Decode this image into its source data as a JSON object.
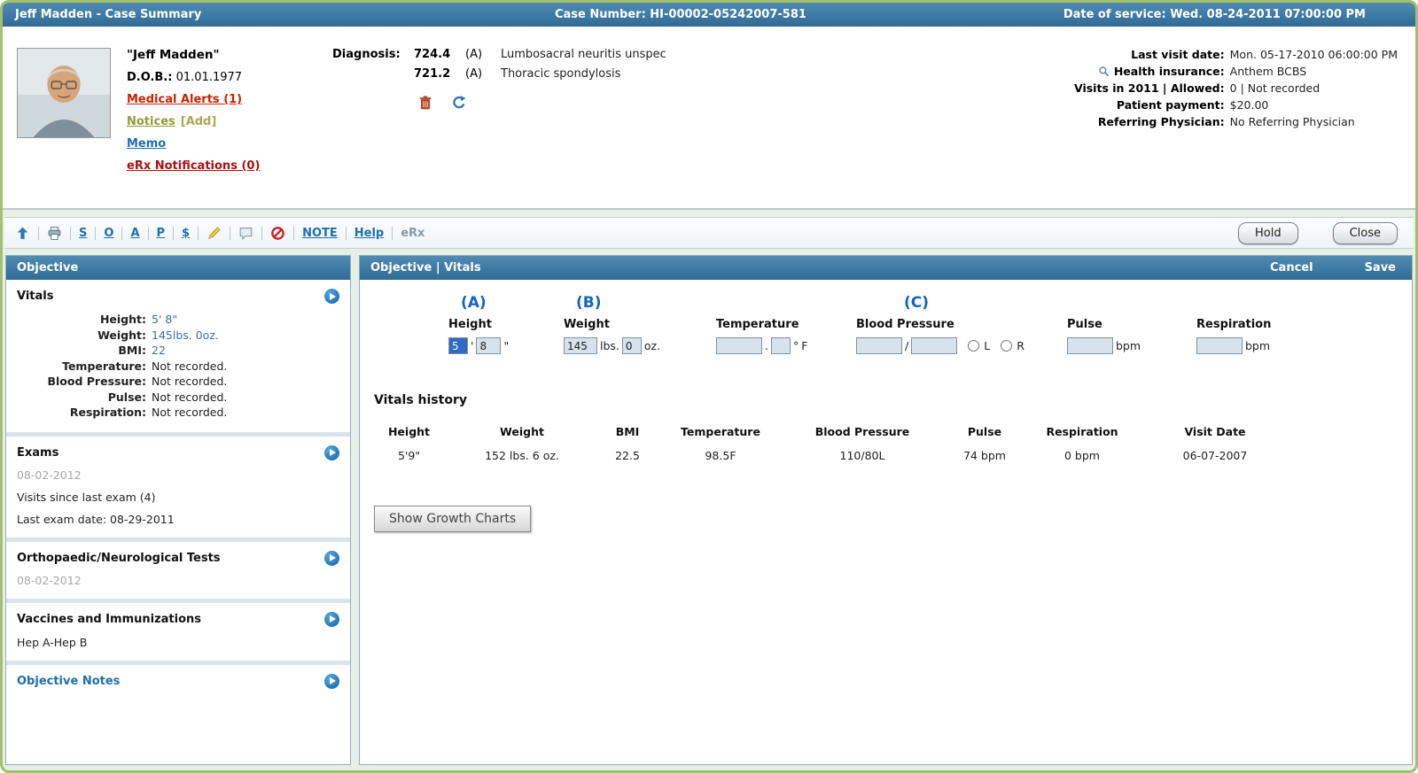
{
  "header": {
    "title": "Jeff Madden - Case Summary",
    "case_number": "Case Number: HI-00002-05242007-581",
    "date_of_service": "Date of service: Wed. 08-24-2011 07:00:00 PM"
  },
  "patient": {
    "name": "\"Jeff Madden\"",
    "dob_label": "D.O.B.:",
    "dob": "01.01.1977",
    "medical_alerts": "Medical Alerts (1)",
    "notices": "Notices",
    "notices_add": "[Add]",
    "memo": "Memo",
    "erx_notifications": "eRx Notifications (0)"
  },
  "diagnosis": {
    "label": "Diagnosis:",
    "items": [
      {
        "code": "724.4",
        "status": "(A)",
        "description": "Lumbosacral neuritis unspec"
      },
      {
        "code": "721.2",
        "status": "(A)",
        "description": "Thoracic spondylosis"
      }
    ]
  },
  "visit_info": {
    "rows": [
      {
        "label": "Last visit date:",
        "value": "Mon. 05-17-2010 06:00:00 PM"
      },
      {
        "label": "Health insurance:",
        "value": "Anthem BCBS"
      },
      {
        "label": "Visits in 2011 | Allowed:",
        "value": "0 | Not recorded"
      },
      {
        "label": "Patient payment:",
        "value": "$20.00"
      },
      {
        "label": "Referring Physician:",
        "value": "No Referring Physician"
      }
    ]
  },
  "toolbar": {
    "links": {
      "s": "S",
      "o": "O",
      "a": "A",
      "p": "P",
      "dollar": "$",
      "note": "NOTE",
      "help": "Help",
      "erx": "eRx"
    },
    "hold": "Hold",
    "close": "Close"
  },
  "sidebar": {
    "title": "Objective",
    "vitals": {
      "title": "Vitals",
      "rows": [
        {
          "label": "Height:",
          "value": "5' 8\""
        },
        {
          "label": "Weight:",
          "value": "145lbs. 0oz."
        },
        {
          "label": "BMI:",
          "value": "22"
        },
        {
          "label": "Temperature:",
          "value": "Not recorded."
        },
        {
          "label": "Blood Pressure:",
          "value": "Not recorded."
        },
        {
          "label": "Pulse:",
          "value": "Not recorded."
        },
        {
          "label": "Respiration:",
          "value": "Not recorded."
        }
      ]
    },
    "exams": {
      "title": "Exams",
      "date": "08-02-2012",
      "line1": "Visits since last exam (4)",
      "line2": "Last exam date: 08-29-2011"
    },
    "ortho": {
      "title": "Orthopaedic/Neurological Tests",
      "date": "08-02-2012"
    },
    "vaccines": {
      "title": "Vaccines and Immunizations",
      "line": "Hep A-Hep B"
    },
    "notes": {
      "title": "Objective Notes"
    }
  },
  "main": {
    "title": "Objective | Vitals",
    "cancel": "Cancel",
    "save": "Save",
    "annotations": {
      "a": "(A)",
      "b": "(B)",
      "c": "(C)"
    },
    "form": {
      "height": {
        "label": "Height",
        "ft": "5",
        "inch": "8",
        "ft_unit": "'",
        "in_unit": "\""
      },
      "weight": {
        "label": "Weight",
        "lbs": "145",
        "oz": "0",
        "lbs_unit": "lbs.",
        "oz_unit": "oz."
      },
      "temperature": {
        "label": "Temperature",
        "whole": "",
        "dot": ".",
        "frac": "",
        "deg": "°",
        "unit": "F"
      },
      "bp": {
        "label": "Blood Pressure",
        "sys": "",
        "dia": "",
        "slash": "/",
        "left": "L",
        "right": "R"
      },
      "pulse": {
        "label": "Pulse",
        "value": "",
        "unit": "bpm"
      },
      "respiration": {
        "label": "Respiration",
        "value": "",
        "unit": "bpm"
      }
    },
    "history": {
      "title": "Vitals history",
      "headers": [
        "Height",
        "Weight",
        "BMI",
        "Temperature",
        "Blood Pressure",
        "Pulse",
        "Respiration",
        "Visit Date"
      ],
      "row": [
        "5'9\"",
        "152 lbs. 6 oz.",
        "22.5",
        "98.5F",
        "110/80L",
        "74 bpm",
        "0 bpm",
        "06-07-2007"
      ]
    },
    "growth_button": "Show Growth Charts"
  }
}
